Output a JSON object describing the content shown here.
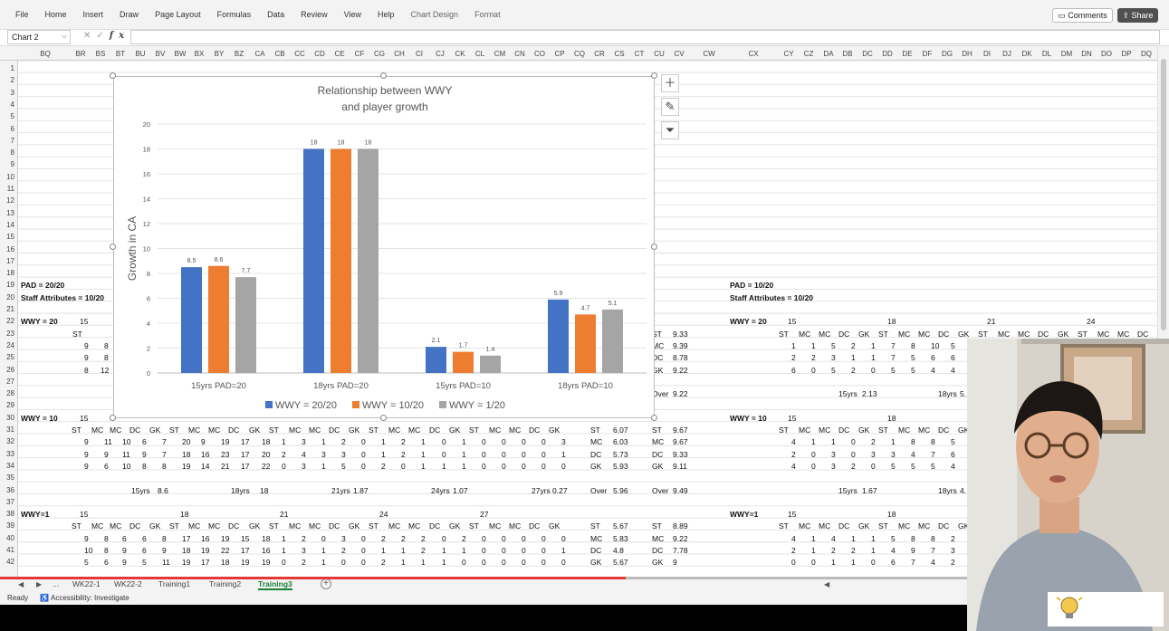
{
  "menu": {
    "tabs": [
      "File",
      "Home",
      "Insert",
      "Draw",
      "Page Layout",
      "Formulas",
      "Data",
      "Review",
      "View",
      "Help",
      "Chart Design",
      "Format"
    ],
    "comments_label": "Comments",
    "share_label": "Share"
  },
  "formula_bar": {
    "name_box": "Chart 2",
    "formula": "",
    "fx_label": "fx"
  },
  "columns_left": [
    "BQ",
    "BR",
    "BS",
    "BT",
    "BU",
    "BV",
    "BW",
    "BX",
    "BY",
    "BZ",
    "CA",
    "CB",
    "CC",
    "CD",
    "CE",
    "CF",
    "CG",
    "CH",
    "CI",
    "CJ",
    "CK",
    "CL",
    "CM",
    "CN",
    "CO",
    "CP",
    "CQ",
    "CR",
    "CS",
    "CT",
    "CU",
    "CV",
    "CW"
  ],
  "columns_right": [
    "CX",
    "CY",
    "CZ",
    "DA",
    "DB",
    "DC",
    "DD",
    "DE",
    "DF",
    "DG",
    "DH",
    "DI",
    "DJ",
    "DK",
    "DL",
    "DM",
    "DN",
    "DO",
    "DP",
    "DQ"
  ],
  "rows": [
    1,
    2,
    3,
    4,
    5,
    6,
    7,
    8,
    9,
    10,
    11,
    12,
    13,
    14,
    15,
    16,
    17,
    18,
    19,
    20,
    21,
    22,
    23,
    24,
    25,
    26,
    27,
    28,
    29,
    30,
    31,
    32,
    33,
    34,
    35,
    36,
    37,
    38,
    39,
    40,
    41,
    42
  ],
  "cells_left": {
    "r19": "PAD = 20/20",
    "r20": "Staff Attributes = 10/20",
    "r22": [
      "WWY = 20",
      "15"
    ],
    "r30": [
      "WWY = 10",
      "15"
    ],
    "r38": [
      "WWY=1",
      "15",
      "18",
      "21",
      "24",
      "27"
    ],
    "pos_header": [
      "ST",
      "MC",
      "MC",
      "DC",
      "GK",
      "ST",
      "MC",
      "MC",
      "DC",
      "GK",
      "ST",
      "MC",
      "MC",
      "DC",
      "GK",
      "ST",
      "MC",
      "MC",
      "DC",
      "GK",
      "ST",
      "MC",
      "MC",
      "DC",
      "GK"
    ],
    "r23_partial": [
      "ST"
    ],
    "r24_partial": [
      "9",
      "8"
    ],
    "r25_partial": [
      "9",
      "8"
    ],
    "r26_partial": [
      "8",
      "12"
    ],
    "r31": [
      "9",
      "11",
      "10",
      "6",
      "7",
      "20",
      "9",
      "19",
      "17",
      "18",
      "1",
      "3",
      "1",
      "2",
      "0",
      "1",
      "2",
      "1",
      "0",
      "1",
      "0",
      "0",
      "0",
      "0",
      "3"
    ],
    "r32": [
      "9",
      "9",
      "11",
      "9",
      "7",
      "18",
      "16",
      "23",
      "17",
      "20",
      "2",
      "4",
      "3",
      "3",
      "0",
      "1",
      "2",
      "1",
      "0",
      "1",
      "0",
      "0",
      "0",
      "0",
      "1"
    ],
    "r33": [
      "9",
      "6",
      "10",
      "8",
      "8",
      "19",
      "14",
      "21",
      "17",
      "22",
      "0",
      "3",
      "1",
      "5",
      "0",
      "2",
      "0",
      "1",
      "1",
      "1",
      "0",
      "0",
      "0",
      "0",
      "0"
    ],
    "r36": [
      "15yrs",
      "8.6",
      "18yrs",
      "18",
      "21yrs",
      "1.87",
      "24yrs",
      "1.07",
      "27yrs",
      "0.27"
    ],
    "r39_header": [
      "ST",
      "MC",
      "MC",
      "DC",
      "GK",
      "ST",
      "MC",
      "MC",
      "DC",
      "GK",
      "ST",
      "MC",
      "MC",
      "DC",
      "GK",
      "ST",
      "MC",
      "MC",
      "DC",
      "GK",
      "ST",
      "MC",
      "MC",
      "DC",
      "GK"
    ],
    "r40": [
      "9",
      "8",
      "6",
      "6",
      "8",
      "17",
      "16",
      "19",
      "15",
      "18",
      "1",
      "2",
      "0",
      "3",
      "0",
      "2",
      "2",
      "2",
      "0",
      "2",
      "0",
      "0",
      "0",
      "0",
      "0"
    ],
    "r41": [
      "10",
      "8",
      "9",
      "6",
      "9",
      "18",
      "19",
      "22",
      "17",
      "16",
      "1",
      "3",
      "1",
      "2",
      "0",
      "1",
      "1",
      "2",
      "1",
      "1",
      "0",
      "0",
      "0",
      "0",
      "1"
    ],
    "r42": [
      "5",
      "6",
      "9",
      "5",
      "11",
      "19",
      "17",
      "18",
      "19",
      "19",
      "0",
      "2",
      "1",
      "0",
      "0",
      "2",
      "1",
      "1",
      "1",
      "0",
      "0",
      "0",
      "0",
      "0",
      "0"
    ],
    "summary_cr_cs": [
      [
        "ST",
        "6.07"
      ],
      [
        "MC",
        "6.03"
      ],
      [
        "DC",
        "5.73"
      ],
      [
        "GK",
        "5.93"
      ],
      [
        "Over",
        "5.96"
      ]
    ],
    "summary_cr_cs_2": [
      [
        "ST",
        "5.67"
      ],
      [
        "MC",
        "5.83"
      ],
      [
        "DC",
        "4.8"
      ],
      [
        "GK",
        "5.67"
      ]
    ],
    "summary_cu_cv_1": [
      [
        "ST",
        "9.33"
      ],
      [
        "MC",
        "9.39"
      ],
      [
        "DC",
        "8.78"
      ],
      [
        "GK",
        "9.22"
      ],
      [
        "Over",
        "9.22"
      ]
    ],
    "summary_cu_cv_2": [
      [
        "ST",
        "9.67"
      ],
      [
        "MC",
        "9.67"
      ],
      [
        "DC",
        "9.33"
      ],
      [
        "GK",
        "9.11"
      ],
      [
        "Over",
        "9.49"
      ]
    ],
    "summary_cu_cv_3": [
      [
        "ST",
        "8.89"
      ],
      [
        "MC",
        "9.22"
      ],
      [
        "DC",
        "7.78"
      ],
      [
        "GK",
        "9"
      ]
    ]
  },
  "cells_right": {
    "r19": "PAD = 10/20",
    "r20": "Staff Attributes = 10/20",
    "r22": [
      "WWY = 20",
      "15",
      "18",
      "21",
      "24"
    ],
    "r23": [
      "ST",
      "MC",
      "MC",
      "DC",
      "GK",
      "ST",
      "MC",
      "MC",
      "DC",
      "GK",
      "ST",
      "MC",
      "MC",
      "DC",
      "GK",
      "ST",
      "MC",
      "MC",
      "DC"
    ],
    "r24": [
      "1",
      "1",
      "5",
      "2",
      "1",
      "7",
      "8",
      "10",
      "5"
    ],
    "r25": [
      "2",
      "2",
      "3",
      "1",
      "1",
      "7",
      "5",
      "6",
      "6"
    ],
    "r26": [
      "6",
      "0",
      "5",
      "2",
      "0",
      "5",
      "5",
      "4",
      "4"
    ],
    "r28": [
      "15yrs",
      "2.13",
      "18yrs",
      "5."
    ],
    "r30": [
      "WWY = 10",
      "15",
      "18"
    ],
    "r31_header": [
      "ST",
      "MC",
      "MC",
      "DC",
      "GK",
      "ST",
      "MC",
      "MC",
      "DC",
      "GK"
    ],
    "r32": [
      "4",
      "1",
      "1",
      "0",
      "2",
      "1",
      "8",
      "8",
      "5"
    ],
    "r33": [
      "2",
      "0",
      "3",
      "0",
      "3",
      "3",
      "4",
      "7",
      "6"
    ],
    "r34": [
      "4",
      "0",
      "3",
      "2",
      "0",
      "5",
      "5",
      "5",
      "4"
    ],
    "r36": [
      "15yrs",
      "1.67",
      "18yrs",
      "4."
    ],
    "r38": [
      "WWY=1",
      "15",
      "18"
    ],
    "r39_header": [
      "ST",
      "MC",
      "MC",
      "DC",
      "GK",
      "ST",
      "MC",
      "MC",
      "DC",
      "GK"
    ],
    "r40": [
      "4",
      "1",
      "4",
      "1",
      "1",
      "5",
      "8",
      "8",
      "2"
    ],
    "r41": [
      "2",
      "1",
      "2",
      "2",
      "1",
      "4",
      "9",
      "7",
      "3"
    ],
    "r42": [
      "0",
      "0",
      "1",
      "1",
      "0",
      "6",
      "7",
      "4",
      "2"
    ]
  },
  "chart_data": {
    "type": "bar",
    "title": "Relationship between WWY and player growth",
    "title_lines": [
      "Relationship between WWY",
      "and player growth"
    ],
    "ylabel": "Growth in CA",
    "xlabel": "",
    "ylim": [
      0,
      20
    ],
    "yticks": [
      0,
      2,
      4,
      6,
      8,
      10,
      12,
      14,
      16,
      18,
      20
    ],
    "categories": [
      "15yrs PAD=20",
      "18yrs PAD=20",
      "15yrs PAD=10",
      "18yrs PAD=10"
    ],
    "series": [
      {
        "name": "WWY = 20/20",
        "color": "#4472c4",
        "values": [
          8.5,
          18,
          2.1,
          5.9
        ]
      },
      {
        "name": "WWY = 10/20",
        "color": "#ed7d31",
        "values": [
          8.6,
          18,
          1.7,
          4.7
        ]
      },
      {
        "name": "WWY = 1/20",
        "color": "#a5a5a5",
        "values": [
          7.7,
          18,
          1.4,
          5.1
        ]
      }
    ],
    "legend_position": "bottom",
    "grid": true
  },
  "sheet_tabs": [
    "...",
    "WK22-1",
    "WK22-2",
    "Training1",
    "Training2",
    "Training3"
  ],
  "active_sheet": "Training3",
  "status": {
    "ready": "Ready",
    "accessibility": "Accessibility: Investigate"
  },
  "video_progress": 0.535
}
